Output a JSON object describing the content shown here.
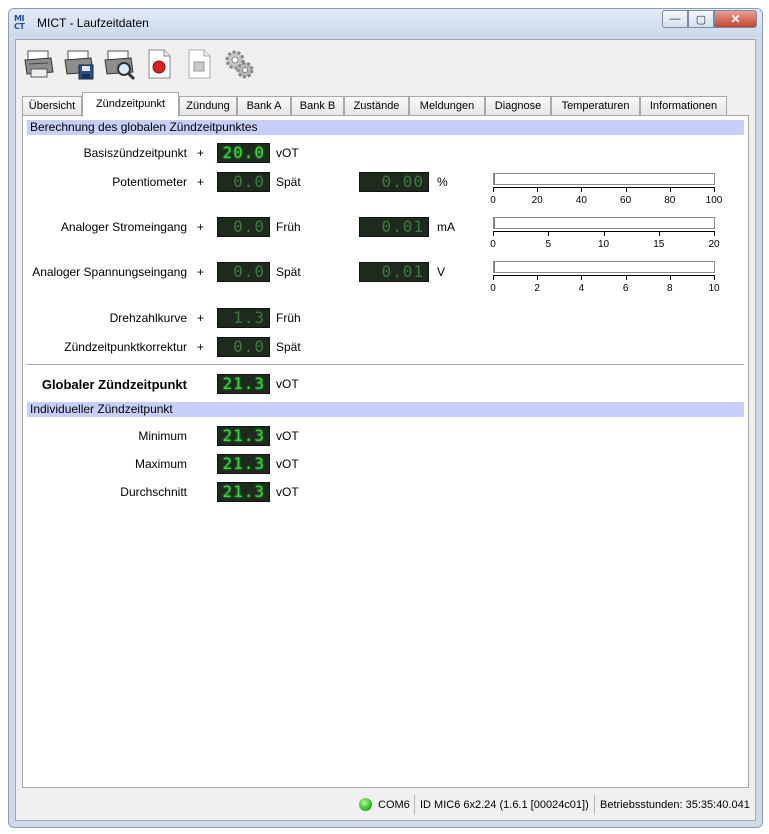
{
  "window": {
    "title": "MICT - Laufzeitdaten",
    "logo_top": "MI",
    "logo_bottom": "CT"
  },
  "window_buttons": {
    "minimize": "—",
    "maximize": "▢",
    "close": "✕"
  },
  "toolbar": {
    "icons": [
      "printer-icon",
      "printer-save-icon",
      "print-preview-icon",
      "record-icon",
      "document-icon",
      "settings-gears-icon"
    ]
  },
  "tabs": [
    "Übersicht",
    "Zündzeitpunkt",
    "Zündung",
    "Bank A",
    "Bank B",
    "Zustände",
    "Meldungen",
    "Diagnose",
    "Temperaturen",
    "Informationen"
  ],
  "active_tab": "Zündzeitpunkt",
  "global": {
    "heading": "Berechnung des globalen Zündzeitpunktes",
    "rows": [
      {
        "label": "Basiszündzeitpunkt",
        "op": "+",
        "value": "20.0",
        "unit": "vOT"
      },
      {
        "label": "Potentiometer",
        "op": "+",
        "value": "0.0",
        "unit": "Spät",
        "raw_value": "0.00",
        "raw_unit": "%"
      },
      {
        "label": "Analoger Stromeingang",
        "op": "+",
        "value": "0.0",
        "unit": "Früh",
        "raw_value": "0.01",
        "raw_unit": "mA"
      },
      {
        "label": "Analoger Spannungseingang",
        "op": "+",
        "value": "0.0",
        "unit": "Spät",
        "raw_value": "0.01",
        "raw_unit": "V"
      },
      {
        "label": "Drehzahlkurve",
        "op": "+",
        "value": "1.3",
        "unit": "Früh"
      },
      {
        "label": "Zündzeitpunktkorrektur",
        "op": "+",
        "value": "0.0",
        "unit": "Spät"
      }
    ],
    "result": {
      "label": "Globaler Zündzeitpunkt",
      "value": "21.3",
      "unit": "vOT"
    }
  },
  "gauges": [
    {
      "value": 0.0,
      "max": 100,
      "ticks": [
        "0",
        "20",
        "40",
        "60",
        "80",
        "100"
      ]
    },
    {
      "value": 0.01,
      "max": 20,
      "ticks": [
        "0",
        "5",
        "10",
        "15",
        "20"
      ]
    },
    {
      "value": 0.01,
      "max": 10,
      "ticks": [
        "0",
        "2",
        "4",
        "6",
        "8",
        "10"
      ]
    }
  ],
  "individual": {
    "heading": "Individueller Zündzeitpunkt",
    "rows": [
      {
        "label": "Minimum",
        "value": "21.3",
        "unit": "vOT"
      },
      {
        "label": "Maximum",
        "value": "21.3",
        "unit": "vOT"
      },
      {
        "label": "Durchschnitt",
        "value": "21.3",
        "unit": "vOT"
      }
    ]
  },
  "status": {
    "port": "COM6",
    "device_id": "ID MIC6 6x2.24 (1.6.1 [00024c01])",
    "operating_hours": "Betriebsstunden: 35:35:40.041"
  },
  "colors": {
    "section_head": "#c6cffa",
    "segment_bg": "#1e2a1e",
    "segment_fg": "#37d43c",
    "led": "#2fbf1e"
  }
}
